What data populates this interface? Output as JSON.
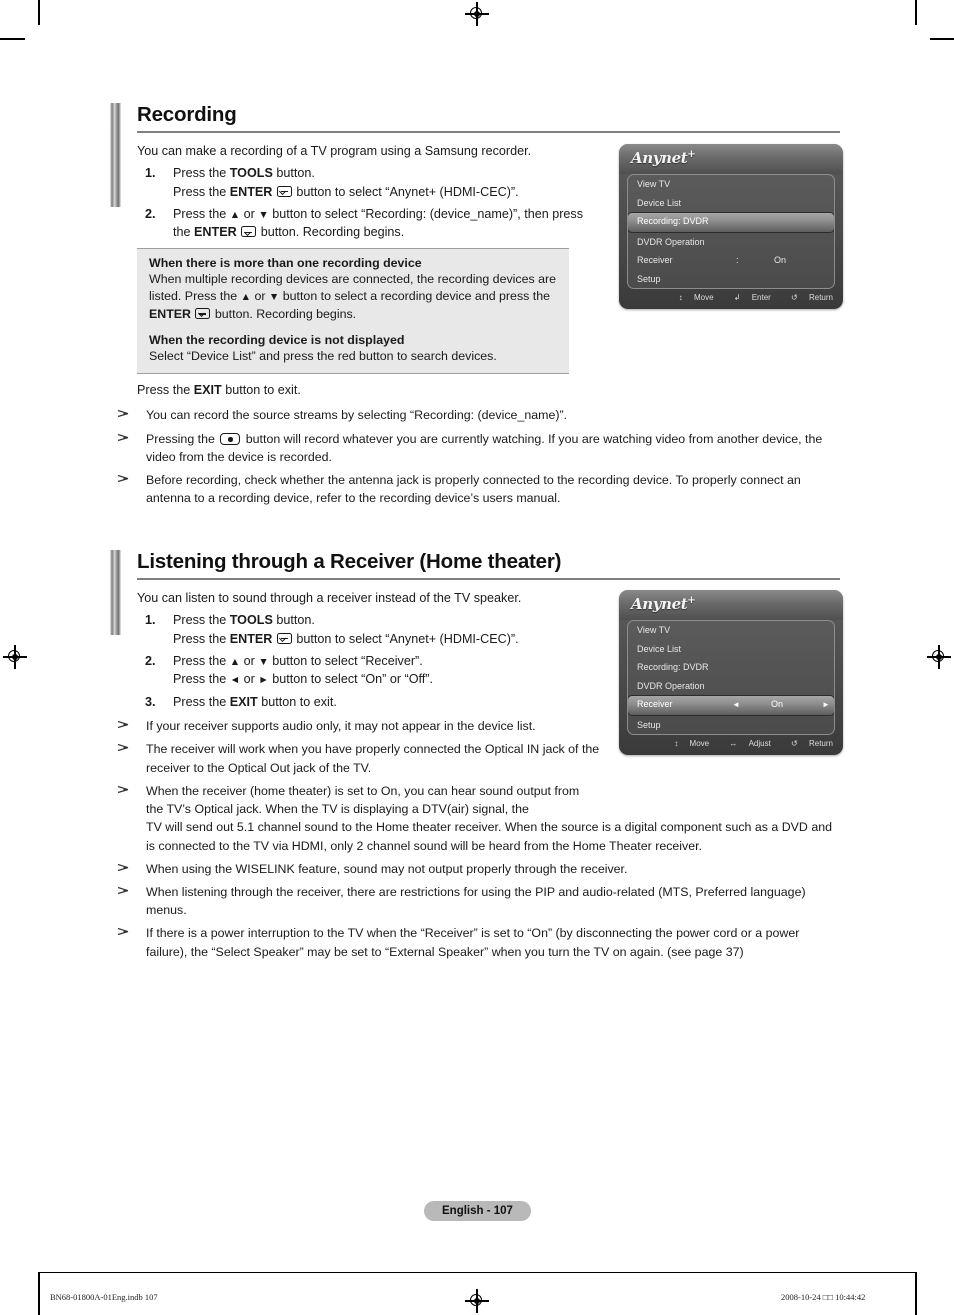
{
  "sections": [
    {
      "id": "recording",
      "title": "Recording",
      "intro": "You can make a recording of a TV program using a Samsung recorder.",
      "steps": [
        {
          "num": "1.",
          "lines": [
            "Press the TOOLS button.",
            "Press the ENTER [E] button to select “Anynet+ (HDMI-CEC)”."
          ]
        },
        {
          "num": "2.",
          "lines": [
            "Press the ▲ or ▼ button to select “Recording: (device_name)”, then press",
            "the ENTER [E] button. Recording begins."
          ]
        }
      ],
      "infobox": [
        {
          "heading": "When there is more than one recording device",
          "body": "When multiple recording devices are connected, the recording devices are listed. Press the ▲ or ▼ button to select a recording device and press the ENTER [E] button. Recording begins."
        },
        {
          "heading": "When the recording device is not displayed",
          "body": "Select “Device List” and press the red button to search devices."
        }
      ],
      "exit_line": "Press the EXIT button to exit.",
      "notes": [
        "You can record the source streams by selecting “Recording: (device_name)”.",
        "Pressing the [REC] button will record whatever you are currently watching. If you are watching video from another device, the video from the device is recorded.",
        "Before recording, check whether the antenna jack is properly connected to the recording device. To properly connect an antenna to a recording device, refer to the recording device’s users manual."
      ]
    },
    {
      "id": "receiver",
      "title": "Listening through a Receiver (Home theater)",
      "intro": "You can listen to sound through a receiver instead of the TV speaker.",
      "steps": [
        {
          "num": "1.",
          "lines": [
            "Press the TOOLS button.",
            "Press the ENTER [E] button to select “Anynet+ (HDMI-CEC)”."
          ]
        },
        {
          "num": "2.",
          "lines": [
            "Press the ▲ or ▼ button to select “Receiver”.",
            "Press the ◄ or ► button to select “On” or “Off”."
          ]
        },
        {
          "num": "3.",
          "lines": [
            "Press the EXIT button to exit."
          ]
        }
      ],
      "notes": [
        "If your receiver supports audio only, it may not appear in the device list.",
        "The receiver will work when you have properly connected the Optical IN jack of the receiver to the Optical Out jack of the TV.",
        "When the receiver (home theater) is set to On, you can hear sound output from the TV’s Optical jack. When the TV is displaying a DTV(air) signal, the TV will send out 5.1 channel sound to the Home theater receiver. When the source is a digital component such as a DVD and is connected to the TV via HDMI, only 2 channel sound will be heard from the Home Theater receiver.",
        "When using the WISELINK feature, sound may not output properly through the receiver.",
        "When listening through the receiver, there are restrictions for using the PIP and audio-related (MTS, Preferred language) menus.",
        "If there is a power interruption to the TV when the “Receiver” is set to “On” (by disconnecting the power cord or a power failure), the “Select Speaker” may be set to “External Speaker” when you turn the TV on again. (see page 37)"
      ]
    }
  ],
  "osd_recording": {
    "logo": "Anynet",
    "logo_sup": "+",
    "rows": [
      {
        "label": "View TV",
        "selected": false
      },
      {
        "label": "Device List",
        "selected": false
      },
      {
        "label": "Recording: DVDR",
        "selected": true
      },
      {
        "label": "DVDR Operation",
        "selected": false
      },
      {
        "label": "Receiver",
        "selected": false,
        "colon": ":",
        "value": "On"
      },
      {
        "label": "Setup",
        "selected": false
      }
    ],
    "hints": [
      {
        "icon": "↕",
        "label": "Move"
      },
      {
        "icon": "↲",
        "label": "Enter"
      },
      {
        "icon": "↺",
        "label": "Return"
      }
    ]
  },
  "osd_receiver": {
    "logo": "Anynet",
    "logo_sup": "+",
    "rows": [
      {
        "label": "View TV",
        "selected": false
      },
      {
        "label": "Device List",
        "selected": false
      },
      {
        "label": "Recording: DVDR",
        "selected": false
      },
      {
        "label": "DVDR Operation",
        "selected": false
      },
      {
        "label": "Receiver",
        "selected": true,
        "left_arrow": "◄",
        "value": "On",
        "right_arrow": "►"
      },
      {
        "label": "Setup",
        "selected": false
      }
    ],
    "hints": [
      {
        "icon": "↕",
        "label": "Move"
      },
      {
        "icon": "↔",
        "label": "Adjust"
      },
      {
        "icon": "↺",
        "label": "Return"
      }
    ]
  },
  "footer": {
    "page_badge": "English - 107",
    "file_ref": "BN68-01800A-01Eng.indb   107",
    "timestamp": "2008-10-24   □□ 10:44:42"
  }
}
